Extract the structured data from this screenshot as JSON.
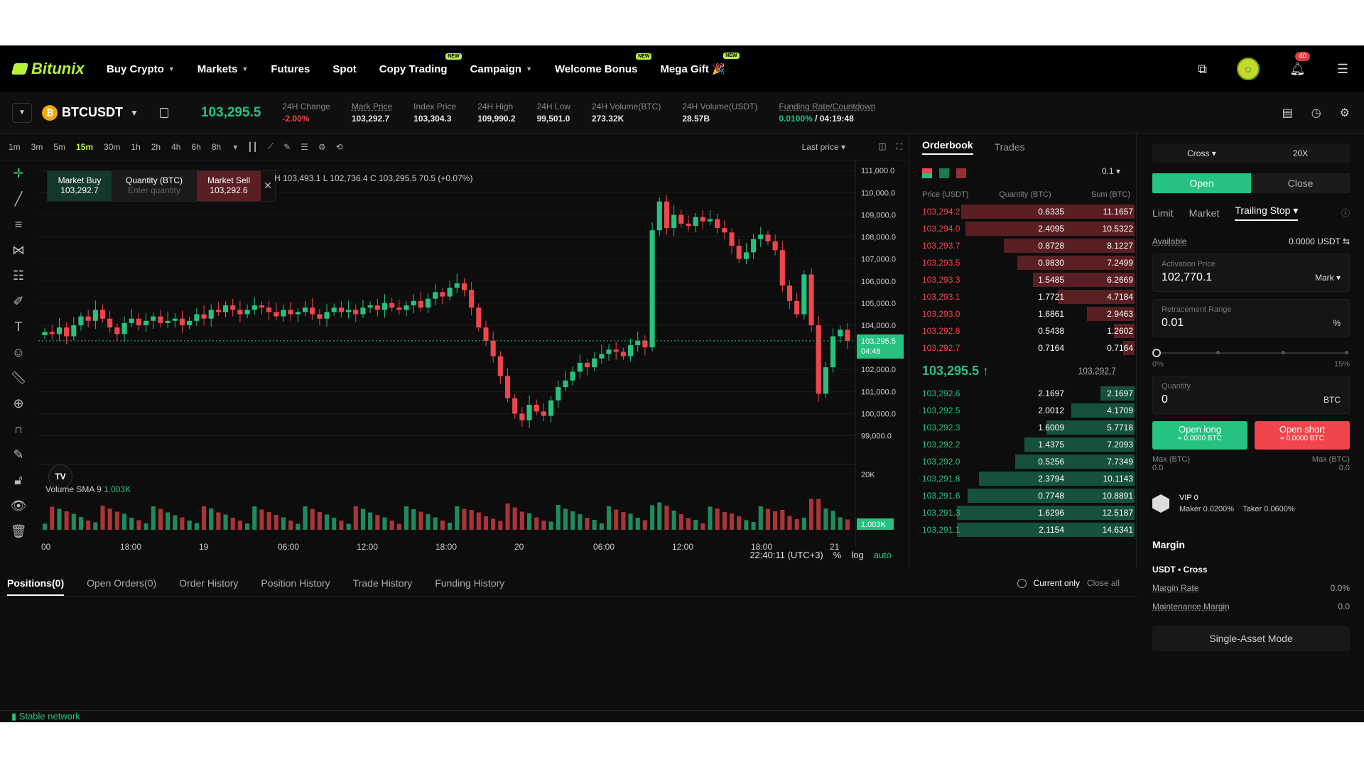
{
  "brand": "Bitunix",
  "nav": [
    {
      "label": "Buy Crypto",
      "caret": true,
      "badge": ""
    },
    {
      "label": "Markets",
      "caret": true,
      "badge": ""
    },
    {
      "label": "Futures",
      "caret": false,
      "badge": ""
    },
    {
      "label": "Spot",
      "caret": false,
      "badge": ""
    },
    {
      "label": "Copy Trading",
      "caret": false,
      "badge": "NEW"
    },
    {
      "label": "Campaign",
      "caret": true,
      "badge": ""
    },
    {
      "label": "Welcome Bonus",
      "caret": false,
      "badge": "NEW"
    },
    {
      "label": "Mega Gift 🎉",
      "caret": false,
      "badge": "NEW"
    }
  ],
  "notifications": "40",
  "ticker": {
    "symbol": "BTCUSDT",
    "last_price": "103,295.5",
    "stats": [
      {
        "label": "24H Change",
        "value": "-2.00%",
        "color": "red",
        "underline": false
      },
      {
        "label": "Mark Price",
        "value": "103,292.7",
        "color": "",
        "underline": true
      },
      {
        "label": "Index Price",
        "value": "103,304.3",
        "color": "",
        "underline": false
      },
      {
        "label": "24H High",
        "value": "109,990.2",
        "color": "",
        "underline": false
      },
      {
        "label": "24H Low",
        "value": "99,501.0",
        "color": "",
        "underline": false
      },
      {
        "label": "24H Volume(BTC)",
        "value": "273.32K",
        "color": "",
        "underline": false
      },
      {
        "label": "24H Volume(USDT)",
        "value": "28.57B",
        "color": "",
        "underline": false
      }
    ],
    "funding": {
      "label": "Funding Rate/Countdown",
      "rate": "0.0100%",
      "countdown": " / 04:19:48"
    }
  },
  "chart": {
    "timeframes": [
      "1m",
      "3m",
      "5m",
      "15m",
      "30m",
      "1h",
      "2h",
      "4h",
      "6h",
      "8h"
    ],
    "active_tf": "15m",
    "price_source": "Last price ▾",
    "order_widget": {
      "buy_label": "Market Buy",
      "buy_price": "103,292.7",
      "qty_label": "Quantity (BTC)",
      "qty_placeholder": "Enter quantity",
      "sell_label": "Market Sell",
      "sell_price": "103,292.6"
    },
    "ohlc": "H 103,493.1  L 102,736.4  C 103,295.5  70.5 (+0.07%)",
    "volume_label": "Volume SMA 9",
    "volume_value": "1.003K",
    "current_price_tag": "103,295.5",
    "countdown_tag": "04:48",
    "volume_tag": "1.003K",
    "vol_axis_top": "20K",
    "time_axis": [
      "00",
      "18:00",
      "19",
      "06:00",
      "12:00",
      "18:00",
      "20",
      "06:00",
      "12:00",
      "18:00",
      "21"
    ],
    "clock": "22:40:11 (UTC+3)",
    "scale_opts": [
      "%",
      "log",
      "auto"
    ]
  },
  "chart_data": {
    "type": "candlestick",
    "y_ticks": [
      111000,
      110000,
      109000,
      108000,
      107000,
      106000,
      105000,
      104000,
      103000,
      102000,
      101000,
      100000,
      99000
    ],
    "y_tick_labels": [
      "111,000.0",
      "110,000.0",
      "109,000.0",
      "108,000.0",
      "107,000.0",
      "106,000.0",
      "105,000.0",
      "104,000.0",
      "",
      "102,000.0",
      "101,000.0",
      "100,000.0",
      "99,000.0"
    ],
    "ylim": [
      98600,
      111200
    ],
    "last_price": 103295.5,
    "closes": [
      103700,
      103600,
      103900,
      103500,
      104000,
      104400,
      104200,
      104700,
      104300,
      103900,
      103600,
      104100,
      104300,
      104000,
      104200,
      104400,
      104100,
      104200,
      104300,
      104000,
      104200,
      104500,
      104300,
      104700,
      104600,
      104900,
      104700,
      104500,
      104700,
      104900,
      104800,
      104600,
      104400,
      104700,
      104500,
      104600,
      104800,
      104500,
      104300,
      104600,
      104800,
      104600,
      104700,
      104500,
      104800,
      104900,
      104700,
      105000,
      104800,
      104700,
      104900,
      105100,
      104800,
      105200,
      105500,
      105300,
      105700,
      105900,
      105600,
      104800,
      103900,
      103300,
      102600,
      101700,
      100700,
      100000,
      99700,
      100400,
      100100,
      99900,
      100600,
      101200,
      101500,
      101900,
      102300,
      102100,
      102500,
      102700,
      102900,
      102800,
      102600,
      103100,
      103300,
      103000,
      108300,
      109600,
      108400,
      109000,
      108600,
      108500,
      108900,
      108700,
      108800,
      108400,
      108200,
      107600,
      107000,
      107300,
      107900,
      108100,
      107800,
      107400,
      105800,
      105100,
      104500,
      106300,
      104000,
      100900,
      102100,
      103500,
      103800,
      103300
    ]
  },
  "orderbook": {
    "tabs": [
      "Orderbook",
      "Trades"
    ],
    "precision": "0.1 ▾",
    "headers": [
      "Price (USDT)",
      "Quantity (BTC)",
      "Sum (BTC)"
    ],
    "asks": [
      {
        "p": "103,294.2",
        "q": "0.6335",
        "s": "11.1657",
        "d": 0.77
      },
      {
        "p": "103,294.0",
        "q": "2.4095",
        "s": "10.5322",
        "d": 0.75
      },
      {
        "p": "103,293.7",
        "q": "0.8728",
        "s": "8.1227",
        "d": 0.58
      },
      {
        "p": "103,293.5",
        "q": "0.9830",
        "s": "7.2499",
        "d": 0.52
      },
      {
        "p": "103,293.3",
        "q": "1.5485",
        "s": "6.2669",
        "d": 0.45
      },
      {
        "p": "103,293.1",
        "q": "1.7721",
        "s": "4.7184",
        "d": 0.34
      },
      {
        "p": "103,293.0",
        "q": "1.6861",
        "s": "2.9463",
        "d": 0.21
      },
      {
        "p": "103,292.8",
        "q": "0.5438",
        "s": "1.2602",
        "d": 0.09
      },
      {
        "p": "103,292.7",
        "q": "0.7164",
        "s": "0.7164",
        "d": 0.05
      }
    ],
    "mid_price": "103,295.5 ↑",
    "mark": "103,292.7",
    "bids": [
      {
        "p": "103,292.6",
        "q": "2.1697",
        "s": "2.1697",
        "d": 0.15
      },
      {
        "p": "103,292.5",
        "q": "2.0012",
        "s": "4.1709",
        "d": 0.28
      },
      {
        "p": "103,292.3",
        "q": "1.6009",
        "s": "5.7718",
        "d": 0.39
      },
      {
        "p": "103,292.2",
        "q": "1.4375",
        "s": "7.2093",
        "d": 0.49
      },
      {
        "p": "103,292.0",
        "q": "0.5256",
        "s": "7.7349",
        "d": 0.53
      },
      {
        "p": "103,291.8",
        "q": "2.3794",
        "s": "10.1143",
        "d": 0.69
      },
      {
        "p": "103,291.6",
        "q": "0.7748",
        "s": "10.8891",
        "d": 0.74
      },
      {
        "p": "103,291.3",
        "q": "1.6296",
        "s": "12.5187",
        "d": 0.85
      },
      {
        "p": "103,291.1",
        "q": "2.1154",
        "s": "14.6341",
        "d": 1.0
      }
    ]
  },
  "orderform": {
    "margin_mode": "Cross ▾",
    "leverage": "20X",
    "open": "Open",
    "close": "Close",
    "types": [
      "Limit",
      "Market",
      "Trailing Stop ▾"
    ],
    "available_label": "Available",
    "available_value": "0.0000 USDT ⇆",
    "activation_label": "Activation Price",
    "activation_value": "102,770.1",
    "activation_suffix": "Mark ▾",
    "retrace_label": "Retracement Range",
    "retrace_value": "0.01",
    "retrace_suffix": "%",
    "slider_min": "0%",
    "slider_max": "15%",
    "qty_label": "Quantity",
    "qty_value": "0",
    "qty_suffix": "BTC",
    "long_label": "Open long",
    "long_sub": "≈ 0.0000 BTC",
    "short_label": "Open short",
    "short_sub": "≈ 0.0000 BTC",
    "max_long": "Max (BTC)",
    "max_long_v": "0.0",
    "max_short": "Max (BTC)",
    "max_short_v": "0.0",
    "vip": "VIP 0",
    "maker": "Maker 0.0200%",
    "taker": "Taker 0.0600%",
    "margin_title": "Margin",
    "margin_sub": "USDT • Cross",
    "margin_rate_label": "Margin Rate",
    "margin_rate": "0.0%",
    "maint_label": "Maintenance Margin",
    "maint_value": "0.0",
    "asset_mode": "Single-Asset Mode"
  },
  "positions": {
    "tabs": [
      "Positions(0)",
      "Open Orders(0)",
      "Order History",
      "Position History",
      "Trade History",
      "Funding History"
    ],
    "current_only": "Current only",
    "close_all": "Close all"
  },
  "status": "Stable network",
  "colors": {
    "green": "#26c281",
    "red": "#f0464b",
    "accent": "#b8f23a"
  }
}
